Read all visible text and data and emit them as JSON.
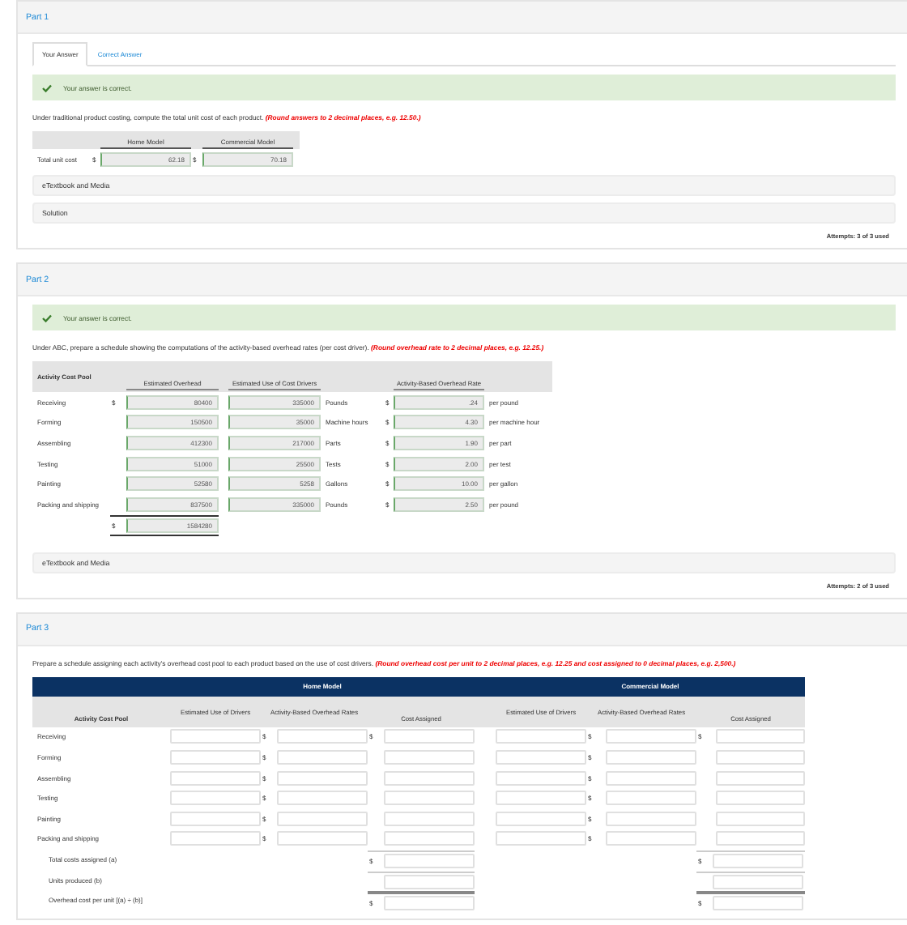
{
  "part1": {
    "title": "Part 1",
    "tabs": [
      {
        "label": "Your Answer",
        "selected": true
      },
      {
        "label": "Correct Answer",
        "selected": false
      }
    ],
    "feedback": "Your answer is correct.",
    "instruction": "Under traditional product costing, compute the total unit cost of each product.",
    "note": "(Round answers to 2 decimal places, e.g. 12.50.)",
    "table": {
      "columns": [
        "Home Model",
        "Commercial Model"
      ],
      "row_label": "Total unit cost",
      "cells": [
        {
          "prefix": "$",
          "value": "62.18"
        },
        {
          "prefix": "$",
          "value": "70.18"
        }
      ]
    },
    "media": "eTextbook and Media",
    "solution": "Solution",
    "attempts": "Attempts: 3 of 3 used"
  },
  "part2": {
    "title": "Part 2",
    "feedback": "Your answer is correct.",
    "instruction": "Under ABC, prepare a schedule showing the computations of the activity-based overhead rates (per cost driver).",
    "note": "(Round overhead rate to 2 decimal places, e.g. 12.25.)",
    "columns": [
      "Activity Cost Pool",
      "Estimated Overhead",
      "Estimated Use of Cost Drivers",
      "Activity-Based Overhead Rate"
    ],
    "rows": [
      {
        "pool": "Receiving",
        "overhead_prefix": "$",
        "overhead": "80400",
        "drivers": "335000",
        "unit": "Pounds",
        "rate_prefix": "$",
        "rate": ".24",
        "per": "per pound"
      },
      {
        "pool": "Forming",
        "overhead": "150500",
        "drivers": "35000",
        "unit": "Machine hours",
        "rate_prefix": "$",
        "rate": "4.30",
        "per": "per machine hour"
      },
      {
        "pool": "Assembling",
        "overhead": "412300",
        "drivers": "217000",
        "unit": "Parts",
        "rate_prefix": "$",
        "rate": "1.90",
        "per": "per part"
      },
      {
        "pool": "Testing",
        "overhead": "51000",
        "drivers": "25500",
        "unit": "Tests",
        "rate_prefix": "$",
        "rate": "2.00",
        "per": "per test"
      },
      {
        "pool": "Painting",
        "overhead": "52580",
        "drivers": "5258",
        "unit": "Gallons",
        "rate_prefix": "$",
        "rate": "10.00",
        "per": "per gallon"
      },
      {
        "pool": "Packing and shipping",
        "overhead": "837500",
        "drivers": "335000",
        "unit": "Pounds",
        "rate_prefix": "$",
        "rate": "2.50",
        "per": "per pound"
      }
    ],
    "total": {
      "prefix": "$",
      "value": "1584280"
    },
    "media": "eTextbook and Media",
    "attempts": "Attempts: 2 of 3 used"
  },
  "part3": {
    "title": "Part 3",
    "instruction": "Prepare a schedule assigning each activity's overhead cost pool to each product based on the use of cost drivers.",
    "note": "(Round overhead cost per unit to 2 decimal places, e.g. 12.25 and cost assigned to 0 decimal places, e.g. 2,500.)",
    "groups": [
      "Home Model",
      "Commercial Model"
    ],
    "columns": [
      "Activity Cost Pool",
      "Estimated Use of Drivers",
      "Activity-Based Overhead Rates",
      "Cost Assigned",
      "Estimated Use of Drivers",
      "Activity-Based Overhead Rates",
      "Cost Assigned"
    ],
    "rows": [
      {
        "label": "Receiving",
        "home": {
          "rate_prefix": "$",
          "cost_prefix": "$"
        },
        "commercial": {
          "rate_prefix": "$",
          "cost_prefix": "$"
        }
      },
      {
        "label": "Forming",
        "home": {
          "rate_prefix": "$"
        },
        "commercial": {
          "rate_prefix": "$"
        }
      },
      {
        "label": "Assembling",
        "home": {
          "rate_prefix": "$"
        },
        "commercial": {
          "rate_prefix": "$"
        }
      },
      {
        "label": "Testing",
        "home": {
          "rate_prefix": "$"
        },
        "commercial": {
          "rate_prefix": "$"
        }
      },
      {
        "label": "Painting",
        "home": {
          "rate_prefix": "$"
        },
        "commercial": {
          "rate_prefix": "$"
        }
      },
      {
        "label": "Packing and shipping",
        "home": {
          "rate_prefix": "$"
        },
        "commercial": {
          "rate_prefix": "$"
        }
      }
    ],
    "totals": [
      {
        "label": "Total costs assigned (a)",
        "prefixes": [
          "$",
          "$"
        ]
      },
      {
        "label": "Units produced (b)"
      },
      {
        "label": "Overhead cost per unit [(a) ÷ (b)]",
        "prefixes": [
          "$",
          "$"
        ]
      }
    ]
  }
}
